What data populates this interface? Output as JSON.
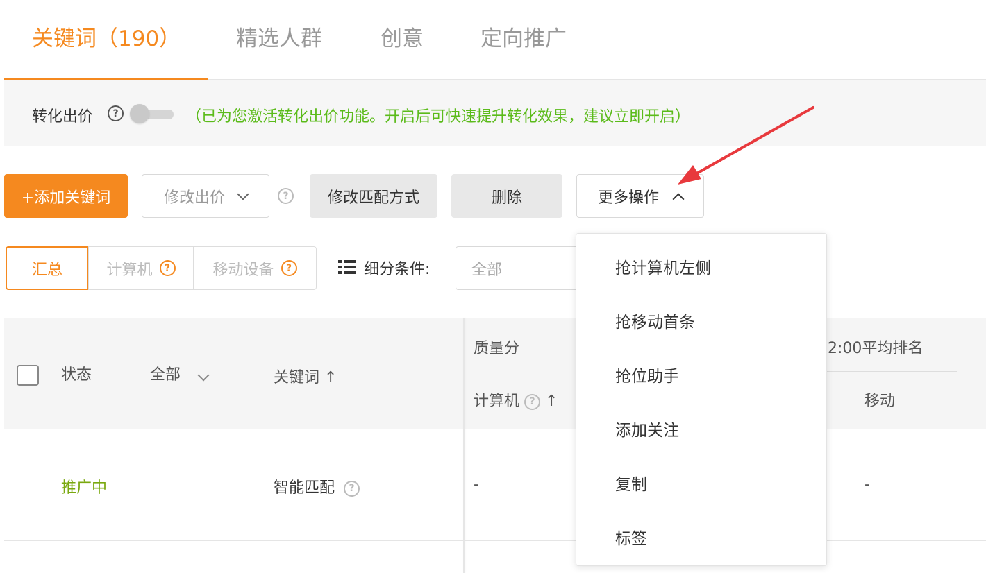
{
  "tabs": [
    {
      "label": "关键词（190）",
      "active": true
    },
    {
      "label": "精选人群"
    },
    {
      "label": "创意"
    },
    {
      "label": "定向推广"
    }
  ],
  "conversion": {
    "label": "转化出价",
    "help": "?",
    "message": "（已为您激活转化出价功能。开启后可快速提升转化效果，建议立即开启）"
  },
  "toolbar": {
    "add_keyword": "+添加关键词",
    "modify_bid": "修改出价",
    "help": "?",
    "modify_match": "修改匹配方式",
    "delete": "删除",
    "more_actions": "更多操作"
  },
  "segments": {
    "summary": "汇总",
    "computer": "计算机",
    "mobile": "移动设备",
    "help": "?",
    "filter_label": "细分条件:",
    "filter_value": "全部"
  },
  "table": {
    "headers": {
      "status": "状态",
      "status_filter": "全部",
      "keyword": "关键词 ↑",
      "quality_score": "质量分",
      "quality_computer": "计算机",
      "sort_up": "↑",
      "rank_partial": "2:00平均排名",
      "rank_mobile": "移动"
    },
    "rows": [
      {
        "status": "推广中",
        "keyword": "智能匹配",
        "quality_computer": "-",
        "rank_mobile": "-"
      }
    ]
  },
  "dropdown": {
    "items": [
      "抢计算机左侧",
      "抢移动首条",
      "抢位助手",
      "添加关注",
      "复制",
      "标签"
    ]
  },
  "colors": {
    "accent": "#f5891f",
    "success": "#5bbb1a",
    "status_active": "#7aa80f",
    "annotation_arrow": "#e8393d"
  }
}
